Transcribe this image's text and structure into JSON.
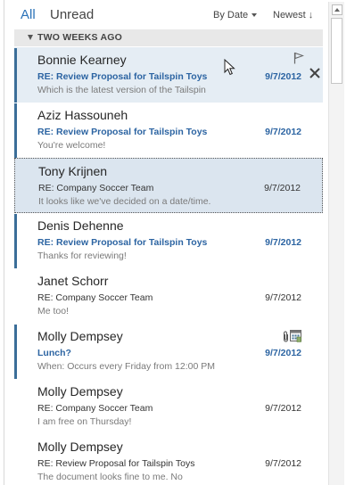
{
  "filters": {
    "all": "All",
    "unread": "Unread"
  },
  "sort": {
    "by": "By Date",
    "order": "Newest"
  },
  "group": {
    "label": "TWO WEEKS AGO"
  },
  "messages": [
    {
      "from": "Bonnie Kearney",
      "subject": "RE: Review Proposal for Tailspin Toys",
      "date": "9/7/2012",
      "preview": "Which is the latest version of the Tailspin",
      "unread": true,
      "state": "hover"
    },
    {
      "from": "Aziz Hassouneh",
      "subject": "RE: Review Proposal for Tailspin Toys",
      "date": "9/7/2012",
      "preview": "You're welcome!",
      "unread": true,
      "state": "normal"
    },
    {
      "from": "Tony Krijnen",
      "subject": "RE: Company Soccer Team",
      "date": "9/7/2012",
      "preview": "It looks like we've decided on a date/time.",
      "unread": false,
      "state": "selected"
    },
    {
      "from": "Denis Dehenne",
      "subject": "RE: Review Proposal for Tailspin Toys",
      "date": "9/7/2012",
      "preview": "Thanks for reviewing!",
      "unread": true,
      "state": "normal"
    },
    {
      "from": "Janet Schorr",
      "subject": "RE: Company Soccer Team",
      "date": "9/7/2012",
      "preview": "Me too!",
      "unread": false,
      "state": "normal"
    },
    {
      "from": "Molly Dempsey",
      "subject": "Lunch?",
      "date": "9/7/2012",
      "preview": "When: Occurs every Friday from 12:00 PM",
      "unread": true,
      "state": "normal"
    },
    {
      "from": "Molly Dempsey",
      "subject": "RE: Company Soccer Team",
      "date": "9/7/2012",
      "preview": "I am free on Thursday!",
      "unread": false,
      "state": "normal"
    },
    {
      "from": "Molly Dempsey",
      "subject": "RE: Review Proposal for Tailspin Toys",
      "date": "9/7/2012",
      "preview": "The document looks fine to me. No",
      "unread": false,
      "state": "normal"
    }
  ],
  "icons": {
    "flag": "flag-icon",
    "delete": "delete-icon",
    "attachment": "paperclip-icon",
    "meeting": "meeting-icon",
    "cursor": "mouse-cursor-icon"
  },
  "colors": {
    "accent": "#2c64a2",
    "unread_bar": "#3b6e99",
    "selected_bg": "#dbe5ef",
    "hover_bg": "#e5edf4",
    "group_bg": "#e8e8e8"
  }
}
